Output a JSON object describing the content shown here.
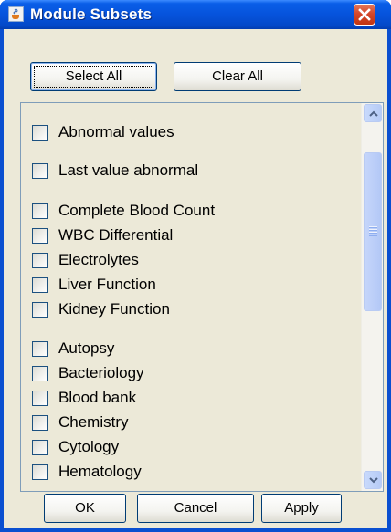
{
  "window": {
    "title": "Module Subsets"
  },
  "toolbar": {
    "select_all_label": "Select All",
    "clear_all_label": "Clear All"
  },
  "modules": {
    "items": [
      {
        "label": "Abnormal values",
        "checked": false
      },
      {
        "label": "Last value abnormal",
        "checked": false
      },
      {
        "label": "Complete Blood Count",
        "checked": false
      },
      {
        "label": "WBC Differential",
        "checked": false
      },
      {
        "label": "Electrolytes",
        "checked": false
      },
      {
        "label": "Liver Function",
        "checked": false
      },
      {
        "label": "Kidney Function",
        "checked": false
      },
      {
        "label": "Autopsy",
        "checked": false
      },
      {
        "label": "Bacteriology",
        "checked": false
      },
      {
        "label": "Blood bank",
        "checked": false
      },
      {
        "label": "Chemistry",
        "checked": false
      },
      {
        "label": "Cytology",
        "checked": false
      },
      {
        "label": "Hematology",
        "checked": false
      }
    ]
  },
  "footer": {
    "ok_label": "OK",
    "cancel_label": "Cancel",
    "apply_label": "Apply"
  },
  "icons": {
    "app": "java-cup-icon",
    "close": "close-icon",
    "scroll_up": "chevron-up-icon",
    "scroll_down": "chevron-down-icon"
  },
  "colors": {
    "titlebar": "#0653dc",
    "dialog_background": "#ece9d8",
    "close_button": "#d4472a"
  }
}
